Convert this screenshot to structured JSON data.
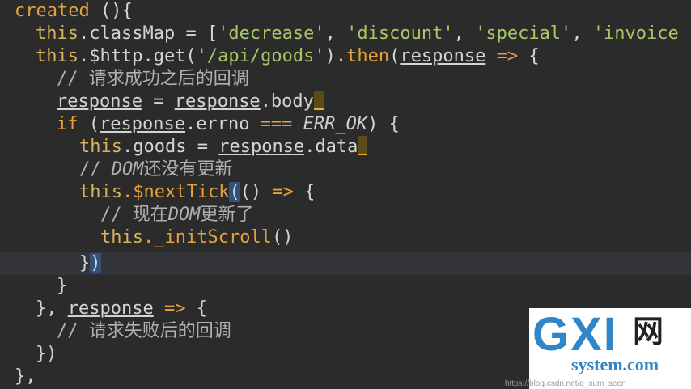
{
  "code": {
    "l1": {
      "kw": "created",
      "rest": " (){"
    },
    "l2": {
      "this": "this",
      "prop": ".classMap",
      "eq": " = [",
      "s1": "'decrease'",
      "s2": "'discount'",
      "s3": "'special'",
      "s4": "'invoice"
    },
    "l3": {
      "this": "this",
      "call": ".$http.get(",
      "url": "'/api/goods'",
      "close": ").",
      "then": "then",
      "paren": "(",
      "param": "response",
      "arrow": " => ",
      "brace": "{"
    },
    "l4": {
      "comment": "// 请求成功之后的回调"
    },
    "l5": {
      "a": "response",
      "eq": " = ",
      "b": "response",
      "tail": ".body"
    },
    "l6": {
      "kw": "if",
      "open": " (",
      "param": "response",
      "prop": ".errno ",
      "op": "===",
      "const": " ERR_OK",
      "close": ") {"
    },
    "l7": {
      "this": "this",
      "prop": ".goods",
      "eq": " = ",
      "param": "response",
      "tail": ".data"
    },
    "l8": {
      "comment": "// ",
      "em": "DOM",
      "rest": "还没有更新"
    },
    "l9": {
      "this": "this",
      "fn": ".$nextTick",
      "paren": "(",
      "mid": "() ",
      "arrow": "=>",
      "brace": " {"
    },
    "l10": {
      "comment": "// 现在",
      "em": "DOM",
      "rest": "更新了"
    },
    "l11": {
      "this": "this",
      "fn": "._initScroll",
      "rest": "()"
    },
    "l12": {
      "a": "}",
      "b": ")"
    },
    "l13": {
      "a": "}"
    },
    "l14": {
      "a": "}, ",
      "param": "response",
      "arrow": " =>",
      "brace": " {"
    },
    "l15": {
      "comment": "// 请求失败后的回调"
    },
    "l16": {
      "a": "})"
    },
    "l17": {
      "a": "},"
    }
  },
  "watermark": {
    "logo": "GXI",
    "cn": "网",
    "site": "system.com",
    "url": "https://blog.csdn.net/q_sum_seen"
  }
}
